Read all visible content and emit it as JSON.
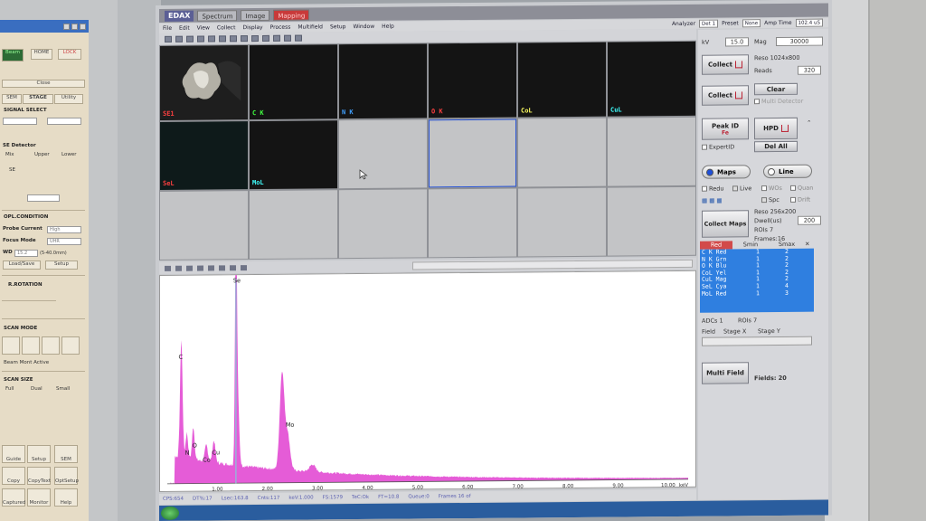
{
  "sem_panel": {
    "status_btn": "Beam",
    "home_btn": "HOME",
    "lock_btn": "LOCK",
    "close_btn": "Close",
    "tabs": [
      "SEM",
      "STAGE",
      "Utility"
    ],
    "signal_select": "SIGNAL SELECT",
    "se_detector": "SE Detector",
    "mix_label": "Mix",
    "upper_label": "Upper",
    "lower_label": "Lower",
    "se_label": "SE",
    "opl_condition": "OPL.CONDITION",
    "probe_current_label": "Probe Current",
    "probe_current_value": "High",
    "focus_mode_label": "Focus Mode",
    "focus_mode_value": "UHR",
    "wd_label": "WD",
    "wd_value": "15.2",
    "wd_range": "(5-40.0mm)",
    "load_save": "Load/Save",
    "setup": "Setup",
    "r_rotation": "R.ROTATION",
    "scan_mode": "SCAN MODE",
    "beam_monitor": "Beam Mont Active",
    "scan_size": "SCAN SIZE",
    "scan_sizes": [
      "Full",
      "Dual",
      "Small"
    ],
    "bottom_buttons": [
      "Guide",
      "Setup",
      "SEM",
      "Copy",
      "CopyText",
      "OptSetup",
      "Captured",
      "Monitor",
      "Help"
    ]
  },
  "app": {
    "logo": "EDAX",
    "tabs": [
      "Spectrum",
      "Image",
      "Mapping"
    ],
    "menu": [
      "File",
      "Edit",
      "View",
      "Collect",
      "Display",
      "Process",
      "Multifield",
      "Setup",
      "Window",
      "Help"
    ],
    "analyzer_label": "Analyzer",
    "analyzer_value": "Det 1",
    "preset_label": "Preset",
    "preset_value": "None",
    "amp_time_label": "Amp Time",
    "amp_time_value": "102.4 uS"
  },
  "maps": [
    {
      "label": "SE1",
      "color": "#ff4040"
    },
    {
      "label": "C K",
      "color": "#40ff40"
    },
    {
      "label": "N K",
      "color": "#40a0ff"
    },
    {
      "label": "O K",
      "color": "#ff4040"
    },
    {
      "label": "CoL",
      "color": "#ffff60"
    },
    {
      "label": "CuL",
      "color": "#40ffff"
    },
    {
      "label": "SeL",
      "color": "#ff4040"
    },
    {
      "label": "MoL",
      "color": "#40ffff"
    }
  ],
  "spectrum": {
    "peak_labels": [
      "Se",
      "C",
      "N",
      "O",
      "Co",
      "Cu",
      "Mo"
    ],
    "x_ticks": [
      "1.00",
      "2.00",
      "3.00",
      "4.00",
      "5.00",
      "6.00",
      "7.00",
      "8.00",
      "9.00",
      "10.00"
    ],
    "x_unit": "keV",
    "trace_color": "#e040d0"
  },
  "status_bar": {
    "cps": "CPS:654",
    "dt": "DT%:17",
    "lsec": "Lsec:163.8",
    "cnts": "Cnts:117",
    "kev": "keV:1.000",
    "fs": "FS:1579",
    "tec": "TeC:Ok",
    "ft": "FT=10.8",
    "queue": "Queue:0",
    "frames": "Frames 16 of"
  },
  "right_panel": {
    "kv_label": "kV",
    "kv_value": "15.0",
    "mag_label": "Mag",
    "mag_value": "30000",
    "collect1": "Collect",
    "reso_label": "Reso 1024x800",
    "reads_label": "Reads",
    "reads_value": "320",
    "collect2": "Collect",
    "clear": "Clear",
    "multi_detector": "Multi Detector",
    "peak_id": "Peak ID",
    "fe": "Fe",
    "hpd": "HPD",
    "expert_id": "ExpertID",
    "del_all": "Del All",
    "maps": "Maps",
    "line": "Line",
    "redu": "Redu",
    "live": "Live",
    "wos": "WOs",
    "quan": "Quan",
    "spc": "Spc",
    "drift": "Drift",
    "collect_maps": "Collect Maps",
    "reso_map": "Reso 256x200",
    "dwell_label": "Dwell(us)",
    "dwell_value": "200",
    "rois": "ROIs 7",
    "frames": "Frames:16",
    "roi_header": [
      "Red",
      "Smin",
      "Smax"
    ],
    "roi_rows": [
      [
        "C K  Red",
        "1",
        "2"
      ],
      [
        "N K  Grn",
        "1",
        "2"
      ],
      [
        "O K  Blu",
        "1",
        "2"
      ],
      [
        "CoL  Yel",
        "1",
        "2"
      ],
      [
        "CuL  Mag",
        "1",
        "2"
      ],
      [
        "SeL  Cya",
        "1",
        "4"
      ],
      [
        "MoL  Red",
        "1",
        "3"
      ]
    ],
    "adcs": "ADCs 1",
    "rois2": "ROIs 7",
    "field_label": "Field",
    "stage_x": "Stage X",
    "stage_y": "Stage Y",
    "multi_field": "Multi Field",
    "fields": "Fields: 20"
  }
}
